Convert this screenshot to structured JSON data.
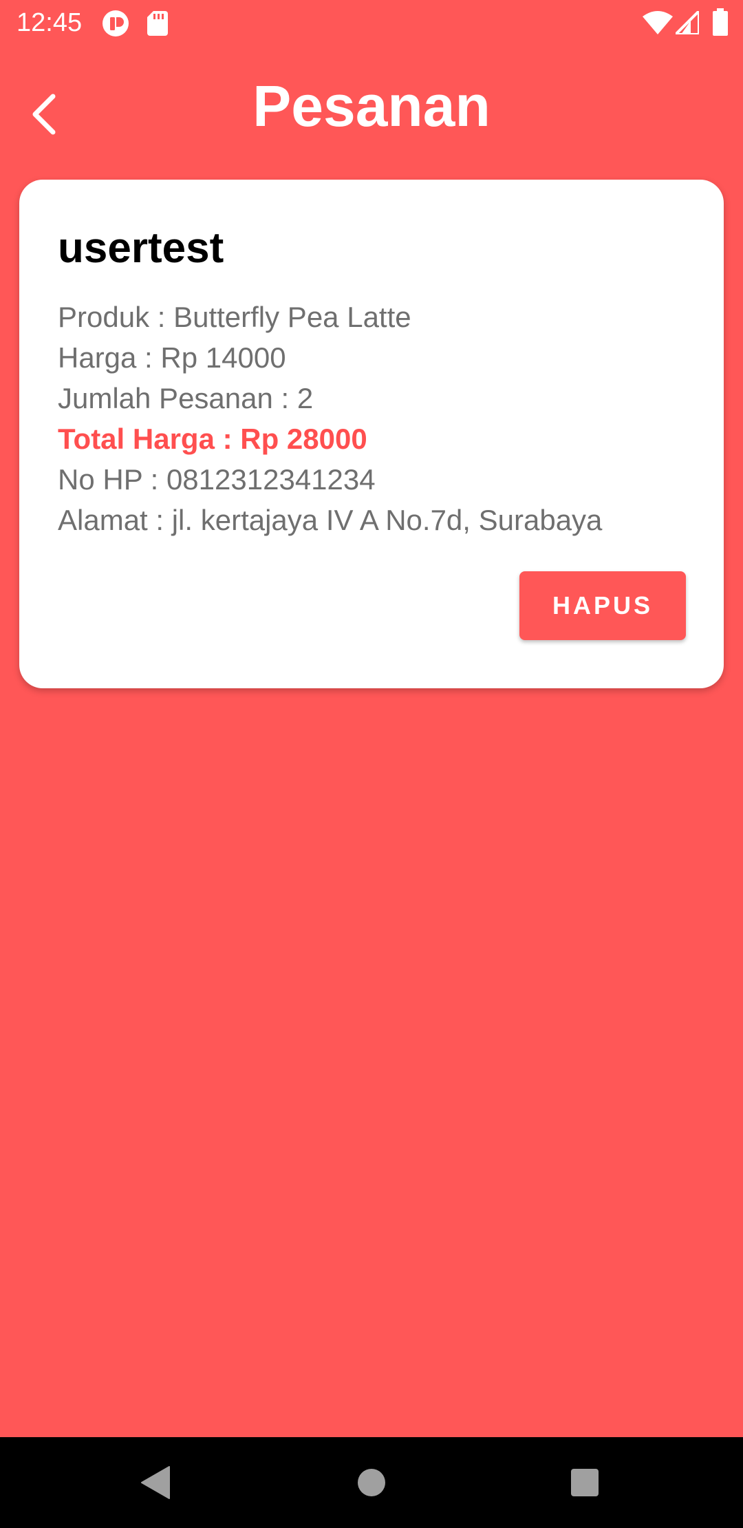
{
  "status_bar": {
    "time": "12:45",
    "icons": [
      "app-notification-icon",
      "sd-card-icon",
      "wifi-icon",
      "signal-icon",
      "battery-icon"
    ]
  },
  "header": {
    "title": "Pesanan",
    "back_icon": "chevron-left-icon"
  },
  "order": {
    "user": "usertest",
    "product_line": "Produk : Butterfly Pea Latte",
    "price_line": "Harga : Rp 14000",
    "quantity_line": "Jumlah Pesanan : 2",
    "total_line": "Total Harga : Rp 28000",
    "phone_line": "No HP : 0812312341234",
    "address_line": "Alamat : jl. kertajaya IV A No.7d, Surabaya",
    "delete_label": "HAPUS"
  },
  "nav_bar": {
    "icons": [
      "back-triangle-icon",
      "home-circle-icon",
      "recents-square-icon"
    ]
  },
  "colors": {
    "background": "#ff5757",
    "card": "#ffffff",
    "total_text": "#ff4f4f",
    "detail_text": "#6f6f6f",
    "nav_bar": "#000000"
  }
}
